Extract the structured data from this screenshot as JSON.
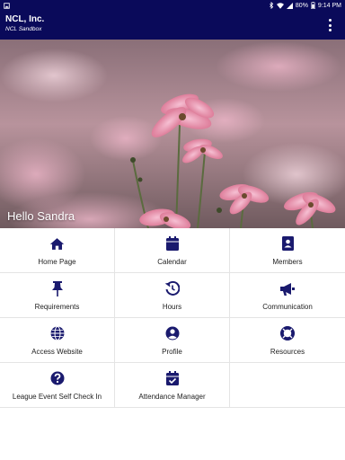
{
  "status_bar": {
    "battery": "80%",
    "time": "9:14 PM"
  },
  "app_bar": {
    "title": "NCL, Inc.",
    "subtitle": "NCL Sandbox"
  },
  "hero": {
    "greeting": "Hello Sandra"
  },
  "colors": {
    "primary": "#0a0a5a",
    "icon": "#1a1a6e"
  },
  "menu_tiles": [
    {
      "label": "Home Page",
      "icon": "home-icon"
    },
    {
      "label": "Calendar",
      "icon": "calendar-icon"
    },
    {
      "label": "Members",
      "icon": "members-icon"
    },
    {
      "label": "Requirements",
      "icon": "pushpin-icon"
    },
    {
      "label": "Hours",
      "icon": "history-icon"
    },
    {
      "label": "Communication",
      "icon": "megaphone-icon"
    },
    {
      "label": "Access Website",
      "icon": "globe-icon"
    },
    {
      "label": "Profile",
      "icon": "profile-icon"
    },
    {
      "label": "Resources",
      "icon": "lifebuoy-icon"
    },
    {
      "label": "League Event Self Check In",
      "icon": "question-icon"
    },
    {
      "label": "Attendance Manager",
      "icon": "calendar-check-icon"
    }
  ]
}
